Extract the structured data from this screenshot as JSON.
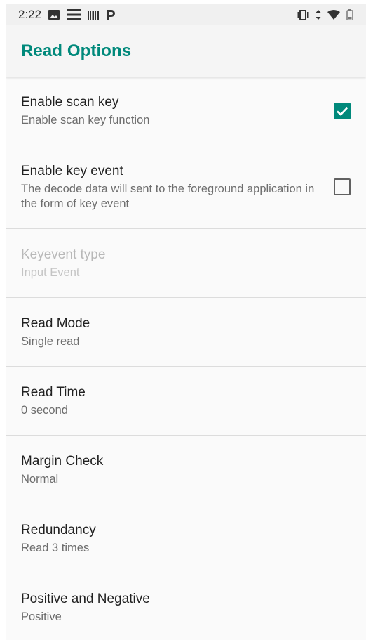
{
  "status_bar": {
    "time": "2:22",
    "icons_left": [
      "image-icon",
      "menu-lines-icon",
      "barcode-icon",
      "parking-icon"
    ],
    "icons_right": [
      "vibrate-icon",
      "data-arrows-icon",
      "wifi-icon",
      "battery-icon"
    ]
  },
  "app_bar": {
    "title": "Read Options"
  },
  "colors": {
    "accent": "#00897b",
    "title_text": "#212121",
    "summary_text": "#6d6d6d"
  },
  "preferences": [
    {
      "title": "Enable scan key",
      "summary": "Enable scan key function",
      "checkbox": true,
      "enabled": true
    },
    {
      "title": "Enable key event",
      "summary": "The decode data will sent to the foreground application in the form of key event",
      "checkbox": false,
      "enabled": true
    },
    {
      "title": "Keyevent type",
      "summary": "Input Event",
      "enabled": false
    },
    {
      "title": "Read Mode",
      "summary": "Single read",
      "enabled": true
    },
    {
      "title": "Read Time",
      "summary": "0 second",
      "enabled": true
    },
    {
      "title": "Margin Check",
      "summary": "Normal",
      "enabled": true
    },
    {
      "title": "Redundancy",
      "summary": "Read 3 times",
      "enabled": true
    },
    {
      "title": "Positive and Negative",
      "summary": "Positive",
      "enabled": true
    }
  ]
}
